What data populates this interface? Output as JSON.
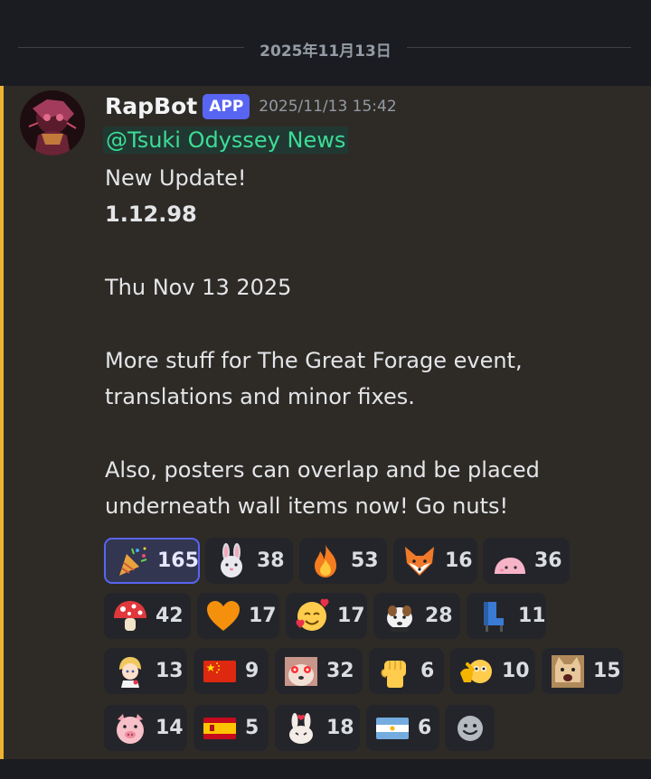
{
  "divider": {
    "date": "2025年11月13日"
  },
  "message": {
    "author": "RapBot",
    "tag": "APP",
    "timestamp": "2025/11/13 15:42",
    "mention": "@Tsuki Odyssey News",
    "lines": [
      "New Update!",
      "1.12.98",
      "Thu Nov 13 2025",
      "More stuff for The Great Forage event,",
      "translations and minor fixes.",
      "Also, posters can overlap and be placed",
      "underneath wall items now! Go nuts!"
    ]
  },
  "reactions": [
    {
      "icon": "party-popper-icon",
      "count": "165"
    },
    {
      "icon": "rabbit-face-icon",
      "count": "38"
    },
    {
      "icon": "fire-icon",
      "count": "53"
    },
    {
      "icon": "fox-face-icon",
      "count": "16"
    },
    {
      "icon": "pink-blob-icon",
      "count": "36"
    },
    {
      "icon": "mushroom-icon",
      "count": "42"
    },
    {
      "icon": "orange-heart-icon",
      "count": "17"
    },
    {
      "icon": "smiling-face-with-hearts-icon",
      "count": "17"
    },
    {
      "icon": "dog-sticker-icon",
      "count": "28"
    },
    {
      "icon": "blue-chair-icon",
      "count": "11"
    },
    {
      "icon": "anime-character-icon",
      "count": "13"
    },
    {
      "icon": "china-flag-icon",
      "count": "9"
    },
    {
      "icon": "glowing-eyes-dog-icon",
      "count": "32"
    },
    {
      "icon": "raised-fist-icon",
      "count": "6"
    },
    {
      "icon": "thinking-hand-icon",
      "count": "10"
    },
    {
      "icon": "screaming-cat-icon",
      "count": "15"
    },
    {
      "icon": "pig-face-icon",
      "count": "14"
    },
    {
      "icon": "spain-flag-icon",
      "count": "5"
    },
    {
      "icon": "heart-bunny-icon",
      "count": "18"
    },
    {
      "icon": "argentina-flag-icon",
      "count": "6"
    }
  ],
  "add_reaction_icon": "add-reaction-smiley-icon",
  "colors": {
    "accent_bar": "#f0b232",
    "mention_text": "#3ddc97",
    "app_tag": "#5865f2",
    "message_bg": "#2e2b27"
  }
}
